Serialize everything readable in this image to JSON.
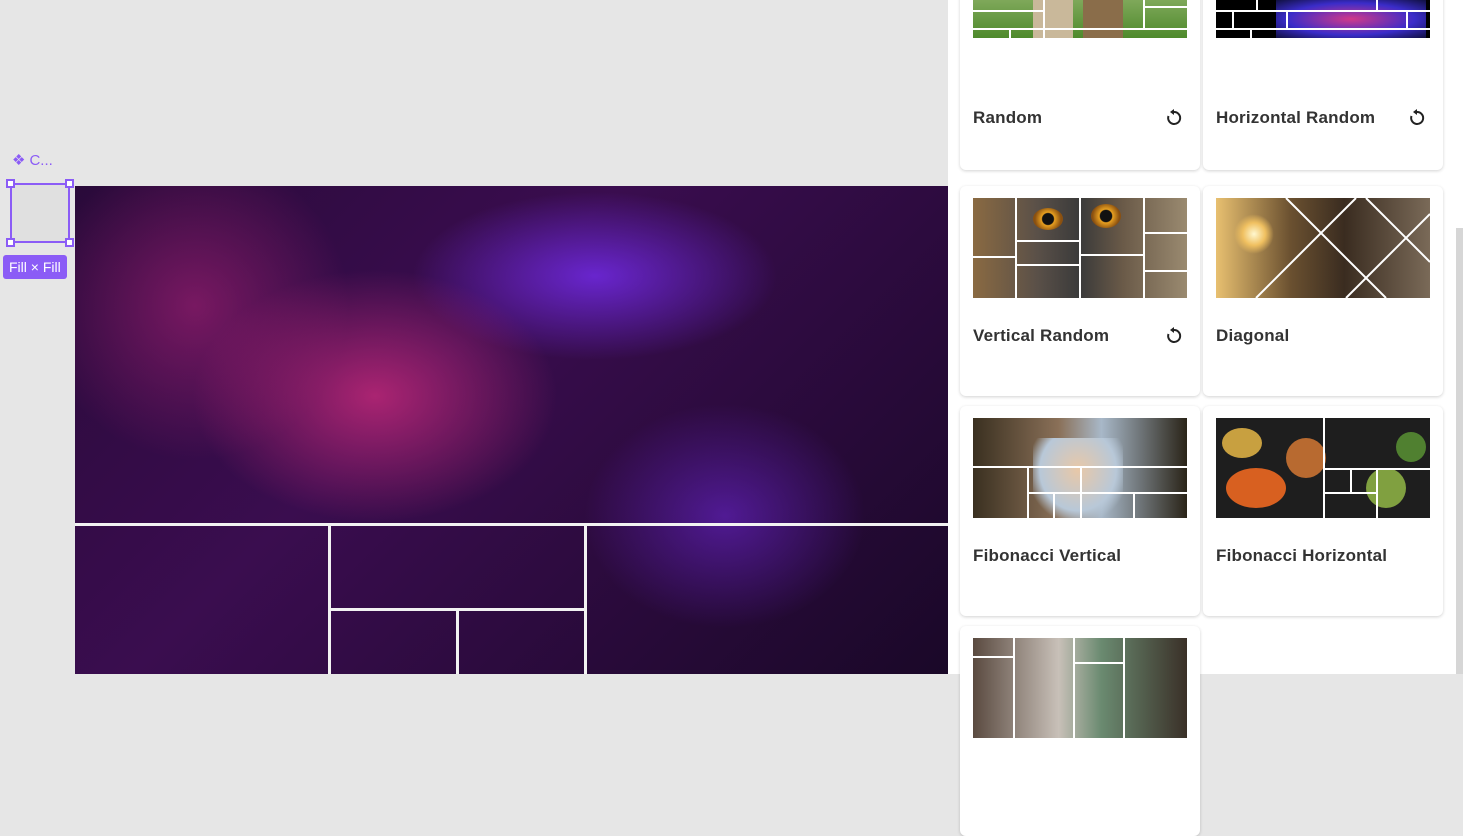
{
  "canvas": {
    "component_label": "C...",
    "size_badge": "Fill × Fill"
  },
  "panel": {
    "cards": [
      {
        "label": "Random",
        "icon": "refresh-icon"
      },
      {
        "label": "Horizontal Random",
        "icon": "refresh-icon"
      },
      {
        "label": "Vertical Random",
        "icon": "refresh-icon"
      },
      {
        "label": "Diagonal"
      },
      {
        "label": "Fibonacci Vertical"
      },
      {
        "label": "Fibonacci Horizontal"
      },
      {
        "label": ""
      }
    ]
  },
  "colors": {
    "selection_accent": "#8b5cf6",
    "card_label": "#333333"
  }
}
